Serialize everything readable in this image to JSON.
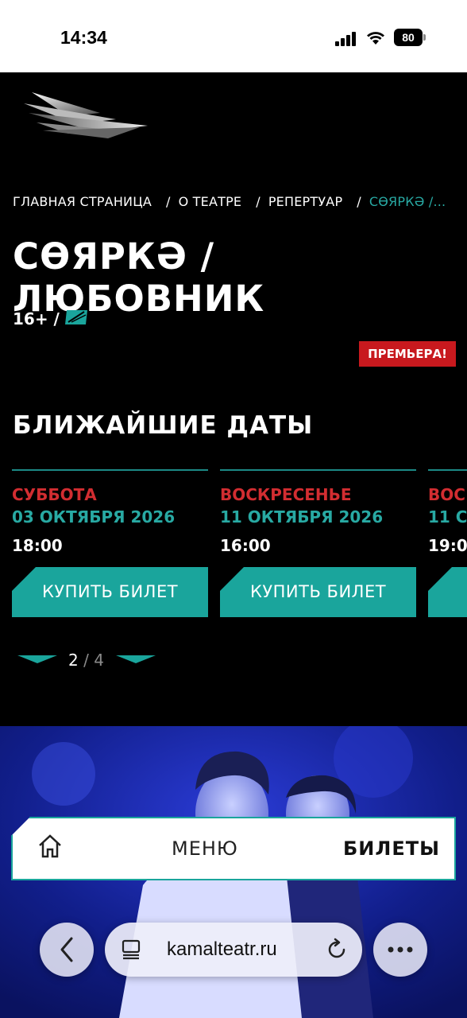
{
  "status_bar": {
    "time": "14:34",
    "battery": "80"
  },
  "breadcrumb": {
    "items": [
      "ГЛАВНАЯ СТРАНИЦА",
      "О ТЕАТРЕ",
      "РЕПЕРТУАР"
    ],
    "current": "СӨЯРКӘ /...",
    "separator": "/"
  },
  "performance": {
    "title": "СӨЯРКӘ / ЛЮБОВНИК",
    "age": "16+ /",
    "badge": "ПРЕМЬЕРА!"
  },
  "dates_section": {
    "title": "БЛИЖАЙШИЕ ДАТЫ",
    "cards": [
      {
        "day": "СУББОТА",
        "date": "03 ОКТЯБРЯ 2026",
        "time": "18:00",
        "button": "КУПИТЬ БИЛЕТ"
      },
      {
        "day": "ВОСКРЕСЕНЬЕ",
        "date": "11 ОКТЯБРЯ 2026",
        "time": "16:00",
        "button": "КУПИТЬ БИЛЕТ"
      },
      {
        "day": "ВОС",
        "date": "11 С",
        "time": "19:0",
        "button": ""
      }
    ],
    "pager": {
      "current": "2",
      "separator": " / ",
      "total": "4"
    }
  },
  "bottom_menu": {
    "menu_label": "МЕНЮ",
    "tickets_label": "БИЛЕТЫ"
  },
  "browser": {
    "url": "kamalteatr.ru"
  },
  "colors": {
    "accent": "#1aa59c",
    "red": "#d22d31",
    "badge": "#c8191e"
  }
}
